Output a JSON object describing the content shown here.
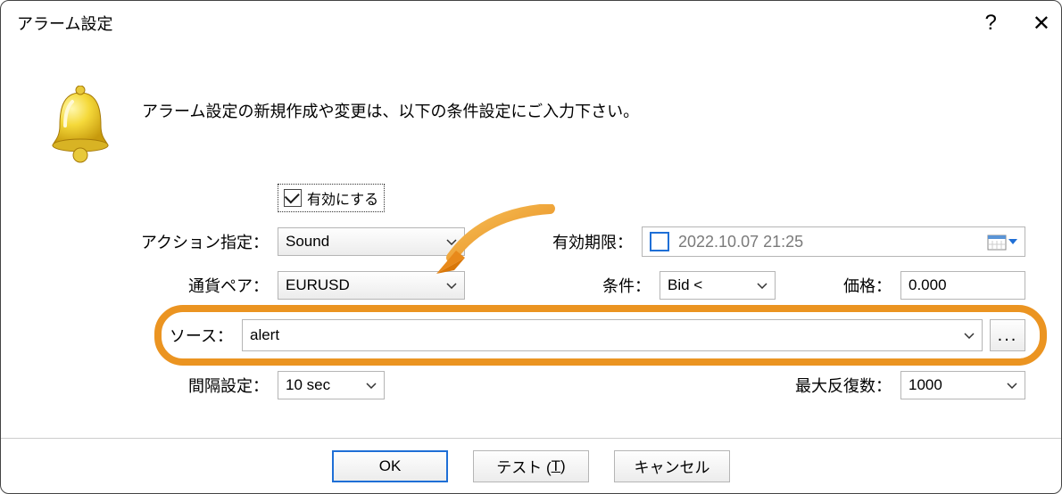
{
  "titlebar": {
    "title": "アラーム設定"
  },
  "icon": "bell-icon",
  "description": "アラーム設定の新規作成や変更は、以下の条件設定にご入力下さい。",
  "enable": {
    "label": "有効にする",
    "checked": true
  },
  "fields": {
    "action": {
      "label": "アクション指定：",
      "value": "Sound"
    },
    "symbol": {
      "label": "通貨ペア：",
      "value": "EURUSD"
    },
    "expiry": {
      "label": "有効期限：",
      "value": "2022.10.07 21:25",
      "checked": false
    },
    "condition": {
      "label": "条件：",
      "value": "Bid <"
    },
    "price": {
      "label": "価格：",
      "value": "0.000"
    },
    "source": {
      "label": "ソース：",
      "value": "alert"
    },
    "interval": {
      "label": "間隔設定：",
      "value": "10 sec"
    },
    "maxrepeat": {
      "label": "最大反復数：",
      "value": "1000"
    }
  },
  "buttons": {
    "ok": "OK",
    "test_prefix": "テスト (",
    "test_u": "T",
    "test_suffix": ")",
    "cancel": "キャンセル"
  }
}
